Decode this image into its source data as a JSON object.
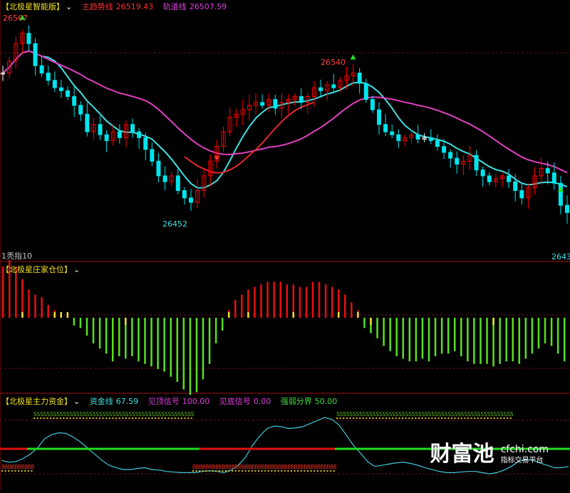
{
  "panels": {
    "price": {
      "name": "【北极星智能版】",
      "chevron": "⌄",
      "trend_label": "主趋势线",
      "trend_value": "26519.43",
      "track_label": "轨道线",
      "track_value": "26507.59",
      "period_label": "1秃指10",
      "price_high_left": "26567",
      "price_high_mid": "26540",
      "price_low_left": "26452",
      "price_low_right": "2643"
    },
    "position": {
      "name": "【北极星庄家仓位】",
      "chevron": "⌄"
    },
    "capital": {
      "name": "【北极星主力资金】",
      "chevron": "⌄",
      "fund_label": "资金线",
      "fund_value": "67.59",
      "top_label": "见顶信号",
      "top_value": "100.00",
      "bottom_label": "见底信号",
      "bottom_value": "0.00",
      "boundary_label": "强弱分界",
      "boundary_value": "50.00"
    }
  },
  "colors": {
    "up": "#ff0000",
    "down": "#00e5ee",
    "neutral": "#ffffff",
    "trend": "#e6282c",
    "track": "#e040c0",
    "ema": "#40e0e0",
    "bar_red": "#e81010",
    "bar_green": "#58e020",
    "bar_yellow": "#f0e030",
    "fund_line": "#40c8d8",
    "mid_green": "#20e020",
    "mid_red": "#e01010",
    "label_yellow": "#f0e020",
    "label_red": "#ff3030",
    "label_magenta": "#e040e0",
    "label_cyan": "#40e0e0",
    "label_green": "#40e040"
  },
  "chart_data": {
    "type": "candlestick",
    "title": "北极星智能版",
    "series_price_path": [
      26540,
      26548,
      26560,
      26567,
      26560,
      26545,
      26540,
      26535,
      26530,
      26528,
      26524,
      26518,
      26512,
      26500,
      26505,
      26498,
      26494,
      26500,
      26496,
      26505,
      26500,
      26496,
      26488,
      26480,
      26470,
      26466,
      26470,
      26460,
      26455,
      26452,
      26460,
      26470,
      26480,
      26490,
      26500,
      26510,
      26512,
      26515,
      26518,
      26520,
      26518,
      26522,
      26516,
      26520,
      26522,
      26524,
      26520,
      26524,
      26530,
      26528,
      26532,
      26530,
      26535,
      26538,
      26540,
      26533,
      26522,
      26515,
      26505,
      26500,
      26498,
      26494,
      26496,
      26498,
      26495,
      26496,
      26494,
      26490,
      26486,
      26482,
      26478,
      26480,
      26484,
      26474,
      26470,
      26466,
      26468,
      26470,
      26466,
      26460,
      26455,
      26462,
      26470,
      26475,
      26472,
      26465,
      26450,
      26445
    ],
    "bar_values": [
      40,
      45,
      40,
      30,
      22,
      18,
      16,
      10,
      6,
      4,
      2,
      -6,
      -8,
      -14,
      -20,
      -24,
      -28,
      -34,
      -30,
      -32,
      -30,
      -34,
      -36,
      -38,
      -40,
      -42,
      -46,
      -50,
      -56,
      -60,
      -58,
      -48,
      -36,
      -20,
      -10,
      6,
      14,
      18,
      22,
      24,
      26,
      28,
      28,
      28,
      26,
      26,
      24,
      24,
      28,
      28,
      26,
      24,
      22,
      18,
      12,
      6,
      -8,
      -12,
      -16,
      -22,
      -26,
      -30,
      -32,
      -34,
      -34,
      -32,
      -34,
      -30,
      -28,
      -28,
      -26,
      -30,
      -34,
      -36,
      -36,
      -36,
      -38,
      -36,
      -34,
      -34,
      -36,
      -32,
      -28,
      -24,
      -20,
      -22,
      -28,
      -34
    ],
    "fund_series": [
      30,
      27,
      28,
      33,
      40,
      50,
      65,
      72,
      75,
      74,
      68,
      60,
      50,
      40,
      30,
      22,
      18,
      15,
      15,
      17,
      18,
      15,
      14,
      12,
      11,
      10,
      10,
      10,
      12,
      13,
      12,
      10,
      14,
      22,
      35,
      55,
      70,
      82,
      86,
      85,
      82,
      83,
      85,
      90,
      95,
      100,
      97,
      88,
      72,
      55,
      42,
      28,
      20,
      22,
      24,
      26,
      27,
      25,
      22,
      18,
      15,
      12,
      10,
      10,
      11,
      12,
      12,
      10,
      8,
      10,
      14,
      20,
      28,
      32,
      30,
      26,
      22,
      18,
      18,
      20
    ],
    "price_labels": [
      "26567",
      "26540",
      "26452",
      "2643"
    ],
    "ylim": [
      26420,
      26580
    ]
  }
}
